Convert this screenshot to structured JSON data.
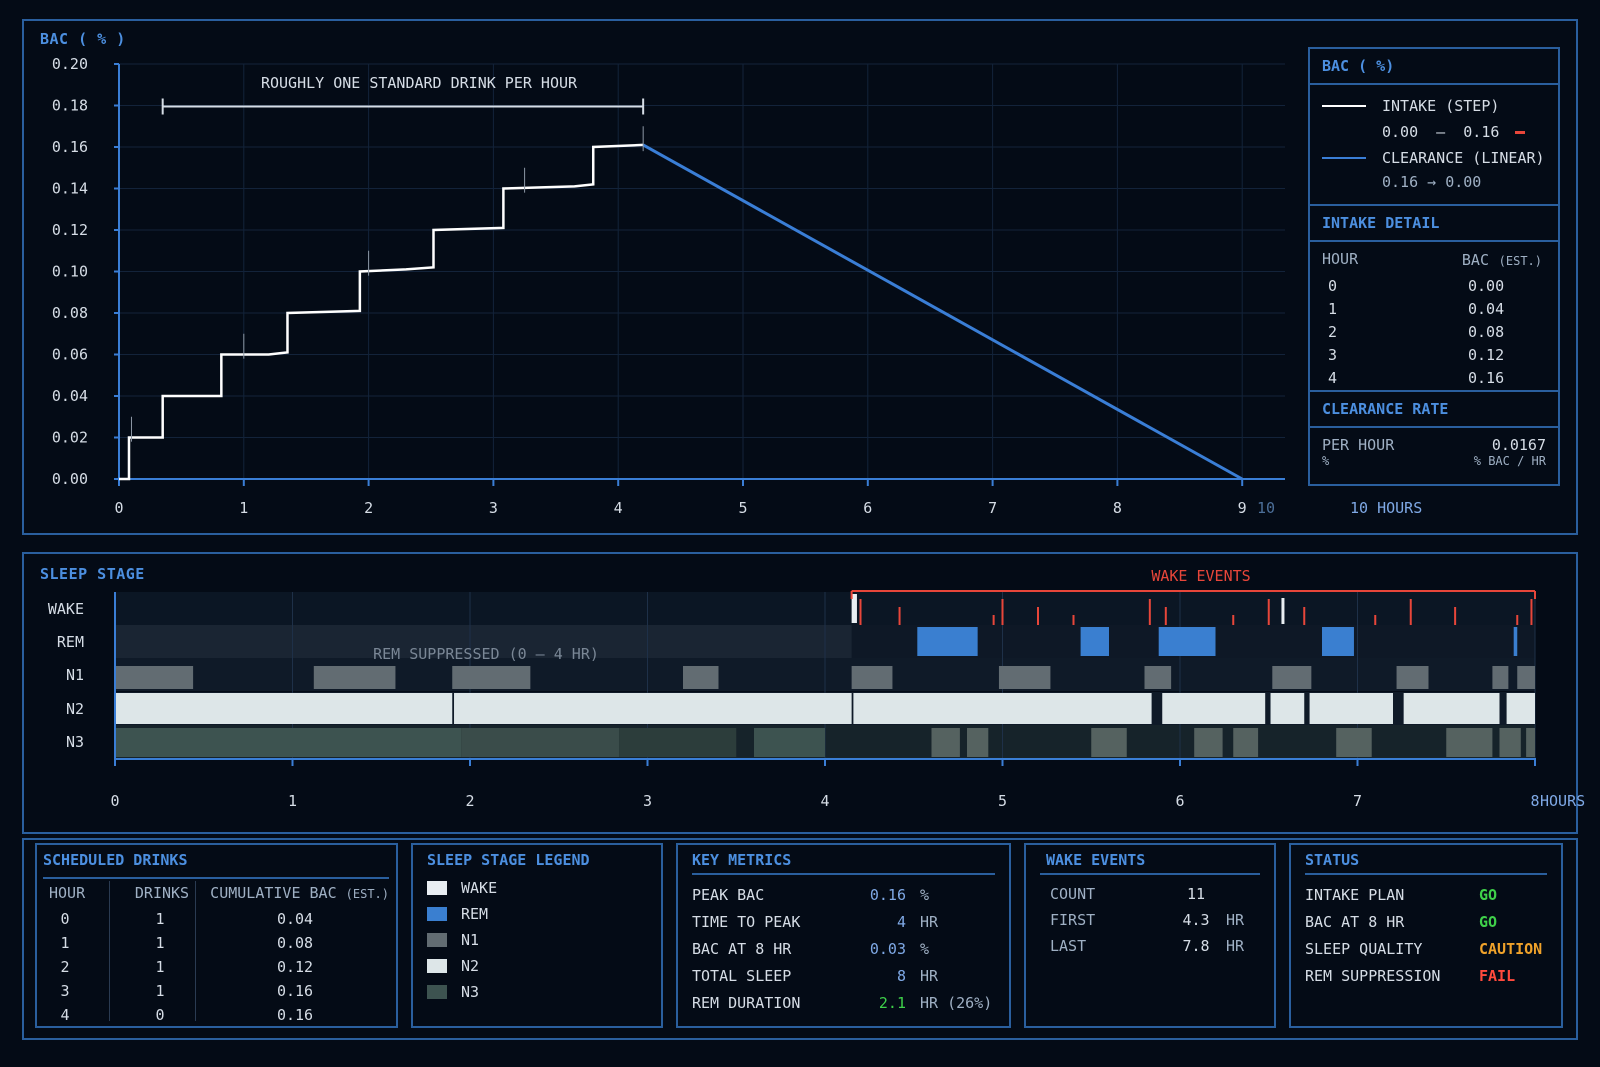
{
  "colors": {
    "background": "#040b16",
    "panel_border": "#2a5f9e",
    "accent_blue": "#4c8fe0",
    "intake_line": "#ffffff",
    "clearance_line": "#3a7ed6",
    "wake_event": "#e8463a",
    "go": "#3fd14a",
    "caution": "#f0a22a",
    "fail": "#ff4a3d",
    "stage_wake": "#e9eef2",
    "stage_rem": "#3a7fd0",
    "stage_n1": "#626c72",
    "stage_n2": "#dde6e8",
    "stage_n3": "#3d5350"
  },
  "bac_chart": {
    "title": "BAC ( % )",
    "annotation": "ROUGHLY ONE STANDARD DRINK PER HOUR",
    "x_unit": "HOURS",
    "x_end_label": "10 HOURS",
    "x_extra_tick": "10",
    "legend": {
      "title": "BAC ( %)",
      "intake_label": "INTAKE (STEP)",
      "intake_range": "0.00  –  0.16",
      "clearance_label": "CLEARANCE (LINEAR)",
      "clearance_range": "0.16 → 0.00",
      "intake_detail_title": "INTAKE DETAIL",
      "col_hour": "HOUR",
      "col_bac": "BAC",
      "col_bac_suffix": "(EST.)",
      "rows": [
        {
          "hour": "0",
          "bac": "0.00"
        },
        {
          "hour": "1",
          "bac": "0.04"
        },
        {
          "hour": "2",
          "bac": "0.08"
        },
        {
          "hour": "3",
          "bac": "0.12"
        },
        {
          "hour": "4",
          "bac": "0.16"
        }
      ],
      "clearance_rate_title": "CLEARANCE RATE",
      "per_hour_label": "PER HOUR",
      "per_hour_value": "0.0167",
      "unit_left": "%",
      "unit_right": "% BAC / HR"
    }
  },
  "sleep_chart": {
    "title": "SLEEP STAGE",
    "wake_events_label": "WAKE EVENTS",
    "rem_suppressed_label": "REM SUPPRESSED (0 – 4 HR)",
    "x_unit": "HOURS"
  },
  "chart_data": [
    {
      "type": "line",
      "title": "BAC ( % )",
      "xlabel": "HOURS",
      "ylabel": "BAC ( % )",
      "xlim": [
        0,
        9.25
      ],
      "ylim": [
        0,
        0.2
      ],
      "x_ticks": [
        "0",
        "1",
        "2",
        "3",
        "4",
        "5",
        "6",
        "7",
        "8",
        "9"
      ],
      "y_ticks": [
        "0.00",
        "0.02",
        "0.04",
        "0.06",
        "0.08",
        "0.10",
        "0.12",
        "0.14",
        "0.16",
        "0.18",
        "0.20"
      ],
      "grid": true,
      "legend_position": "right",
      "series": [
        {
          "name": "INTAKE (STEP)",
          "style": "step",
          "points": [
            [
              0,
              0.0
            ],
            [
              0.08,
              0.0
            ],
            [
              0.08,
              0.02
            ],
            [
              0.35,
              0.02
            ],
            [
              0.35,
              0.04
            ],
            [
              0.82,
              0.04
            ],
            [
              0.82,
              0.06
            ],
            [
              1.2,
              0.06
            ],
            [
              1.35,
              0.061
            ],
            [
              1.35,
              0.08
            ],
            [
              1.93,
              0.081
            ],
            [
              1.93,
              0.1
            ],
            [
              2.3,
              0.101
            ],
            [
              2.52,
              0.102
            ],
            [
              2.52,
              0.12
            ],
            [
              3.08,
              0.121
            ],
            [
              3.08,
              0.14
            ],
            [
              3.65,
              0.141
            ],
            [
              3.8,
              0.142
            ],
            [
              3.8,
              0.16
            ],
            [
              4.2,
              0.161
            ]
          ]
        },
        {
          "name": "CLEARANCE (LINEAR)",
          "style": "linear",
          "points": [
            [
              4.2,
              0.161
            ],
            [
              9.0,
              0.0
            ]
          ]
        }
      ],
      "annotations": [
        {
          "text": "ROUGHLY ONE STANDARD DRINK PER HOUR",
          "x_start": 0.35,
          "x_end": 4.2,
          "y": 0.18
        }
      ]
    },
    {
      "type": "heatmap",
      "title": "SLEEP STAGE",
      "xlabel": "HOURS",
      "xlim": [
        0,
        8
      ],
      "x_ticks": [
        "0",
        "1",
        "2",
        "3",
        "4",
        "5",
        "6",
        "7",
        "8"
      ],
      "stages": [
        "WAKE",
        "REM",
        "N1",
        "N2",
        "N3"
      ],
      "segments": {
        "WAKE": [
          [
            4.15,
            4.18
          ]
        ],
        "REM": [
          [
            4.52,
            4.86
          ],
          [
            5.44,
            5.6
          ],
          [
            5.88,
            6.2
          ],
          [
            6.8,
            6.98
          ],
          [
            7.88,
            7.9
          ]
        ],
        "N1": [
          [
            0.0,
            0.44
          ],
          [
            1.12,
            1.58
          ],
          [
            1.9,
            2.34
          ],
          [
            3.2,
            3.4
          ],
          [
            4.15,
            4.38
          ],
          [
            4.98,
            5.27
          ],
          [
            5.8,
            5.95
          ],
          [
            6.52,
            6.74
          ],
          [
            7.22,
            7.4
          ],
          [
            7.76,
            7.85
          ],
          [
            7.9,
            8.0
          ]
        ],
        "N2": [
          [
            0.0,
            1.9
          ],
          [
            1.91,
            4.15
          ],
          [
            4.16,
            5.84
          ],
          [
            5.9,
            6.48
          ],
          [
            6.51,
            6.7
          ],
          [
            6.73,
            7.2
          ],
          [
            7.26,
            7.8
          ],
          [
            7.84,
            8.0
          ]
        ],
        "N3": [
          [
            0.0,
            1.95
          ],
          [
            1.95,
            2.84
          ],
          [
            2.84,
            3.5
          ],
          [
            3.6,
            4.0
          ],
          [
            4.6,
            4.76
          ],
          [
            4.8,
            4.92
          ],
          [
            5.5,
            5.7
          ],
          [
            6.08,
            6.24
          ],
          [
            6.3,
            6.44
          ],
          [
            6.88,
            7.08
          ],
          [
            7.5,
            7.76
          ],
          [
            7.8,
            7.92
          ],
          [
            7.95,
            8.0
          ]
        ]
      },
      "wake_events_x": [
        4.2,
        4.42,
        4.95,
        5.0,
        5.2,
        5.4,
        5.83,
        5.92,
        6.3,
        6.5,
        6.7,
        7.1,
        7.3,
        7.55,
        7.9,
        7.98
      ],
      "wake_events_range": [
        4.15,
        8.0
      ]
    }
  ],
  "scheduled_drinks": {
    "title": "SCHEDULED DRINKS",
    "col_hour": "HOUR",
    "col_drinks": "DRINKS",
    "col_bac": "CUMULATIVE BAC",
    "col_bac_suffix": "(EST.)",
    "rows": [
      {
        "hour": "0",
        "drinks": "1",
        "bac": "0.04"
      },
      {
        "hour": "1",
        "drinks": "1",
        "bac": "0.08"
      },
      {
        "hour": "2",
        "drinks": "1",
        "bac": "0.12"
      },
      {
        "hour": "3",
        "drinks": "1",
        "bac": "0.16"
      },
      {
        "hour": "4",
        "drinks": "0",
        "bac": "0.16"
      }
    ]
  },
  "sleep_legend": {
    "title": "SLEEP STAGE LEGEND",
    "items": [
      {
        "label": "WAKE",
        "color": "#e9eef2"
      },
      {
        "label": "REM",
        "color": "#3a7fd0"
      },
      {
        "label": "N1",
        "color": "#626c72"
      },
      {
        "label": "N2",
        "color": "#dde6e8"
      },
      {
        "label": "N3",
        "color": "#3d5350"
      }
    ]
  },
  "key_metrics": {
    "title": "KEY METRICS",
    "rows": [
      {
        "label": "PEAK BAC",
        "value": "0.16",
        "unit": "%"
      },
      {
        "label": "TIME TO PEAK",
        "value": "4",
        "unit": "HR"
      },
      {
        "label": "BAC AT 8 HR",
        "value": "0.03",
        "unit": "%"
      },
      {
        "label": "TOTAL SLEEP",
        "value": "8",
        "unit": "HR"
      },
      {
        "label": "REM DURATION",
        "value": "2.1",
        "unit": "HR (26%)"
      }
    ]
  },
  "wake_events": {
    "title": "WAKE EVENTS",
    "rows": [
      {
        "label": "COUNT",
        "value": "11",
        "unit": ""
      },
      {
        "label": "FIRST",
        "value": "4.3",
        "unit": "HR"
      },
      {
        "label": "LAST",
        "value": "7.8",
        "unit": "HR"
      }
    ]
  },
  "status": {
    "title": "STATUS",
    "rows": [
      {
        "label": "INTAKE PLAN",
        "value": "GO",
        "level": "go"
      },
      {
        "label": "BAC AT 8 HR",
        "value": "GO",
        "level": "go"
      },
      {
        "label": "SLEEP QUALITY",
        "value": "CAUTION",
        "level": "caution"
      },
      {
        "label": "REM SUPPRESSION",
        "value": "FAIL",
        "level": "fail"
      }
    ]
  }
}
